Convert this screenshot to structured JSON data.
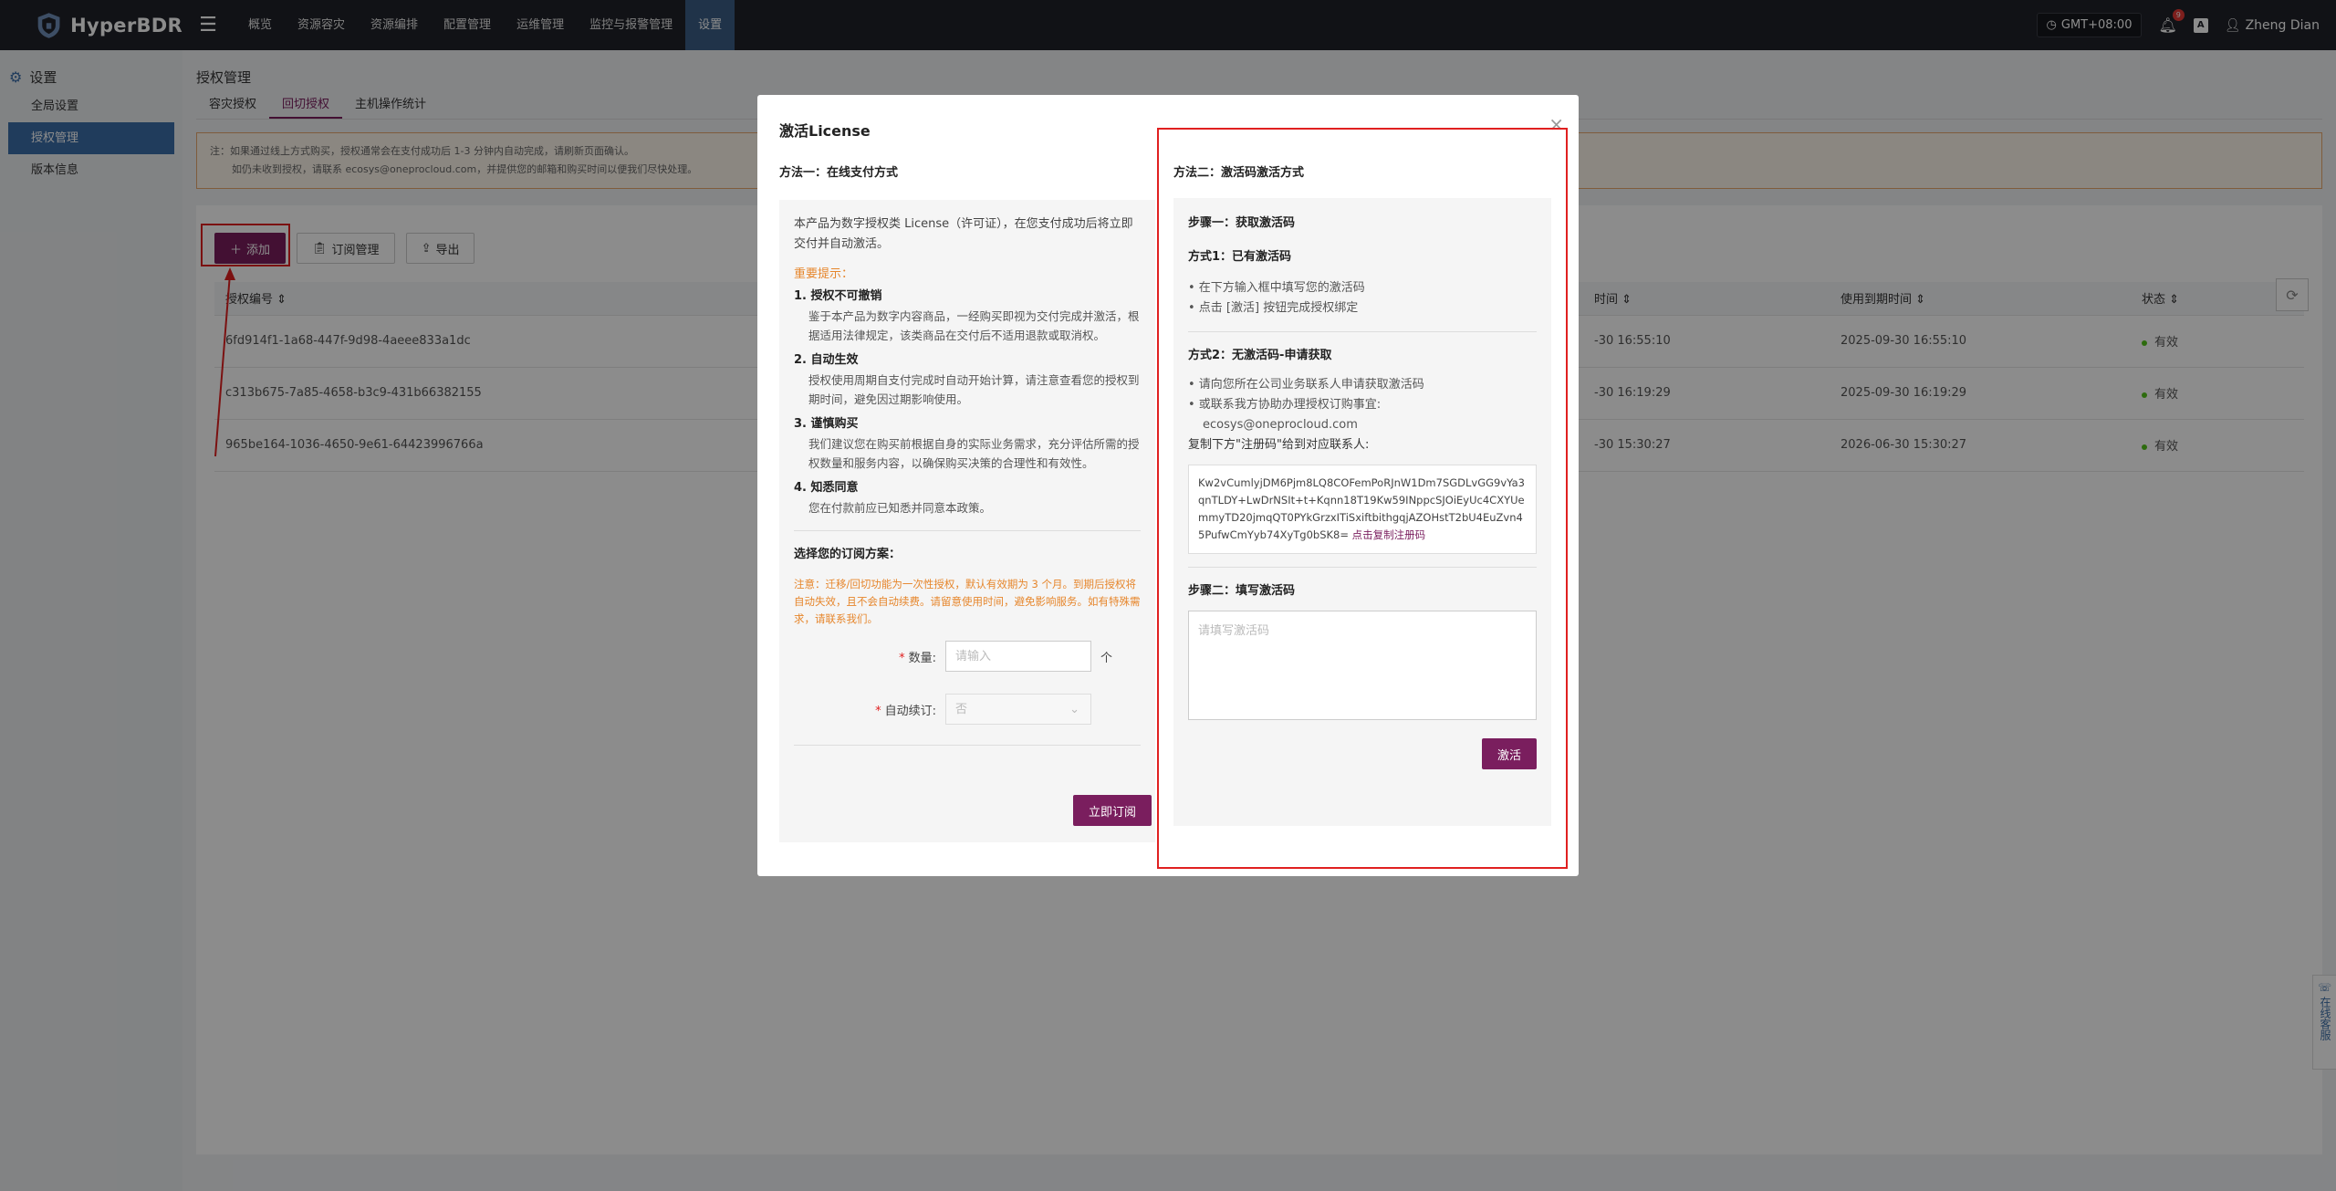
{
  "app": {
    "name": "HyperBDR",
    "nav": [
      "概览",
      "资源容灾",
      "资源编排",
      "配置管理",
      "运维管理",
      "监控与报警管理",
      "设置"
    ],
    "active_nav": 6,
    "timezone": "GMT+08:00",
    "notification_count": "9",
    "lang_icon": "A",
    "user": "Zheng Dian"
  },
  "sidebar": {
    "title": "设置",
    "items": [
      "全局设置",
      "授权管理",
      "版本信息"
    ],
    "active": 1
  },
  "main": {
    "title": "授权管理",
    "tabs": [
      "容灾授权",
      "回切授权",
      "主机操作统计"
    ],
    "active_tab": 1,
    "notice": {
      "line1": "注：如果通过线上方式购买，授权通常会在支付成功后 1-3 分钟内自动完成，请刷新页面确认。",
      "line2": "如仍未收到授权，请联系 ecosys@oneprocloud.com，并提供您的邮箱和购买时间以便我们尽快处理。"
    },
    "toolbar": {
      "add": "添加",
      "subscription": "订阅管理",
      "export": "导出"
    },
    "table": {
      "headers": [
        "授权编号",
        "时间",
        "使用到期时间",
        "状态"
      ],
      "rows": [
        {
          "id": "6fd914f1-1a68-447f-9d98-4aeee833a1dc",
          "start": "-30 16:55:10",
          "expire": "2025-09-30 16:55:10",
          "status": "有效"
        },
        {
          "id": "c313b675-7a85-4658-b3c9-431b66382155",
          "start": "-30 16:19:29",
          "expire": "2025-09-30 16:19:29",
          "status": "有效"
        },
        {
          "id": "965be164-1036-4650-9e61-64423996766a",
          "start": "-30 15:30:27",
          "expire": "2026-06-30 15:30:27",
          "status": "有效"
        }
      ]
    }
  },
  "modal": {
    "title": "激活License",
    "left": {
      "heading": "方法一：在线支付方式",
      "intro": "本产品为数字授权类 License（许可证），在您支付成功后将立即交付并自动激活。",
      "warn_head": "重要提示：",
      "points": [
        {
          "title": "1. 授权不可撤销",
          "text": "鉴于本产品为数字内容商品，一经购买即视为交付完成并激活，根据适用法律规定，该类商品在交付后不适用退款或取消权。"
        },
        {
          "title": "2. 自动生效",
          "text": "授权使用周期自支付完成时自动开始计算，请注意查看您的授权到期时间，避免因过期影响使用。"
        },
        {
          "title": "3. 谨慎购买",
          "text": "我们建议您在购买前根据自身的实际业务需求，充分评估所需的授权数量和服务内容，以确保购买决策的合理性和有效性。"
        },
        {
          "title": "4. 知悉同意",
          "text": "您在付款前应已知悉并同意本政策。"
        }
      ],
      "plan_title": "选择您的订阅方案：",
      "plan_note": "注意：迁移/回切功能为一次性授权，默认有效期为 3 个月。到期后授权将自动失效，且不会自动续费。请留意使用时间，避免影响服务。如有特殊需求，请联系我们。",
      "quantity_label": "数量:",
      "quantity_placeholder": "请输入",
      "quantity_unit": "个",
      "auto_renew_label": "自动续订:",
      "auto_renew_value": "否",
      "subscribe_button": "立即订阅"
    },
    "right": {
      "heading": "方法二：激活码激活方式",
      "step1": "步骤一：获取激活码",
      "way1_title": "方式1：已有激活码",
      "way1_bullets": [
        "• 在下方输入框中填写您的激活码",
        "• 点击 [激活] 按钮完成授权绑定"
      ],
      "way2_title": "方式2：无激活码-申请获取",
      "way2_bullets": [
        "• 请向您所在公司业务联系人申请获取激活码",
        "• 或联系我方协助办理授权订购事宜:"
      ],
      "contact_email": "ecosys@oneprocloud.com",
      "copy_instruction": "复制下方\"注册码\"给到对应联系人:",
      "registration_code": "Kw2vCumlyjDM6Pjm8LQ8COFemPoRJnW1Dm7SGDLvGG9vYa3qnTLDY+LwDrNSIt+t+Kqnn18T19Kw59INppcSJOiEyUc4CXYUemmyTD20jmqQT0PYkGrzxITiSxiftbithgqjAZOHstT2bU4EuZvn45PufwCmYyb74XyTg0bSK8=",
      "copy_link": "点击复制注册码",
      "step2": "步骤二：填写激活码",
      "code_placeholder": "请填写激活码",
      "activate_button": "激活"
    }
  },
  "service_widget": "在线客服"
}
